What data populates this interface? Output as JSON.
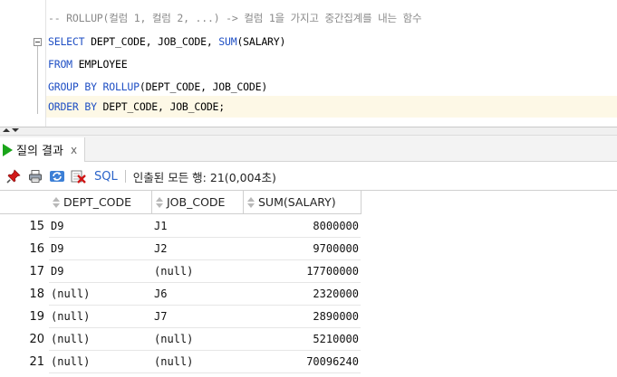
{
  "editor": {
    "lines": [
      {
        "id": "line1",
        "parts": [
          {
            "cls": "cm",
            "text": "-- ROLLUP(컬럼 1, 컬럼 2, ...) -> 컬럼 1을 가지고 중간집계를 내는 함수"
          }
        ]
      },
      {
        "id": "line2",
        "parts": [
          {
            "cls": "kw",
            "text": "SELECT"
          },
          {
            "cls": "tx",
            "text": " DEPT_CODE, JOB_CODE, "
          },
          {
            "cls": "kw",
            "text": "SUM"
          },
          {
            "cls": "tx",
            "text": "(SALARY)"
          }
        ]
      },
      {
        "id": "line3",
        "parts": [
          {
            "cls": "kw",
            "text": "FROM"
          },
          {
            "cls": "tx",
            "text": " EMPLOYEE"
          }
        ]
      },
      {
        "id": "line4",
        "parts": [
          {
            "cls": "kw",
            "text": "GROUP BY ROLLUP"
          },
          {
            "cls": "tx",
            "text": "(DEPT_CODE, JOB_CODE)"
          }
        ]
      },
      {
        "id": "line5",
        "parts": [
          {
            "cls": "kw",
            "text": "ORDER BY"
          },
          {
            "cls": "tx",
            "text": " DEPT_CODE, JOB_CODE;"
          }
        ]
      }
    ]
  },
  "results": {
    "tab_label": "질의 결과",
    "tab_close": "x",
    "toolbar": {
      "sql_label": "SQL",
      "status_label": "인출된 모든 행:",
      "status_value": "21(0,004초)"
    },
    "columns": [
      "DEPT_CODE",
      "JOB_CODE",
      "SUM(SALARY)"
    ],
    "rows": [
      {
        "n": "15",
        "dept": "D9",
        "job": "J1",
        "sum": "8000000"
      },
      {
        "n": "16",
        "dept": "D9",
        "job": "J2",
        "sum": "9700000"
      },
      {
        "n": "17",
        "dept": "D9",
        "job": "(null)",
        "sum": "17700000"
      },
      {
        "n": "18",
        "dept": "(null)",
        "job": "J6",
        "sum": "2320000"
      },
      {
        "n": "19",
        "dept": "(null)",
        "job": "J7",
        "sum": "2890000"
      },
      {
        "n": "20",
        "dept": "(null)",
        "job": "(null)",
        "sum": "5210000"
      },
      {
        "n": "21",
        "dept": "(null)",
        "job": "(null)",
        "sum": "70096240"
      }
    ]
  },
  "colors": {
    "keyword": "#1f4fc4",
    "comment": "#8a8a8a",
    "current_line": "#fdf8e6",
    "run_icon": "#1aa51a",
    "sql_link": "#2a63c9"
  },
  "icons": {
    "pin": "pin-icon",
    "print": "print-icon",
    "refresh": "refresh-icon",
    "delete": "delete-icon"
  }
}
